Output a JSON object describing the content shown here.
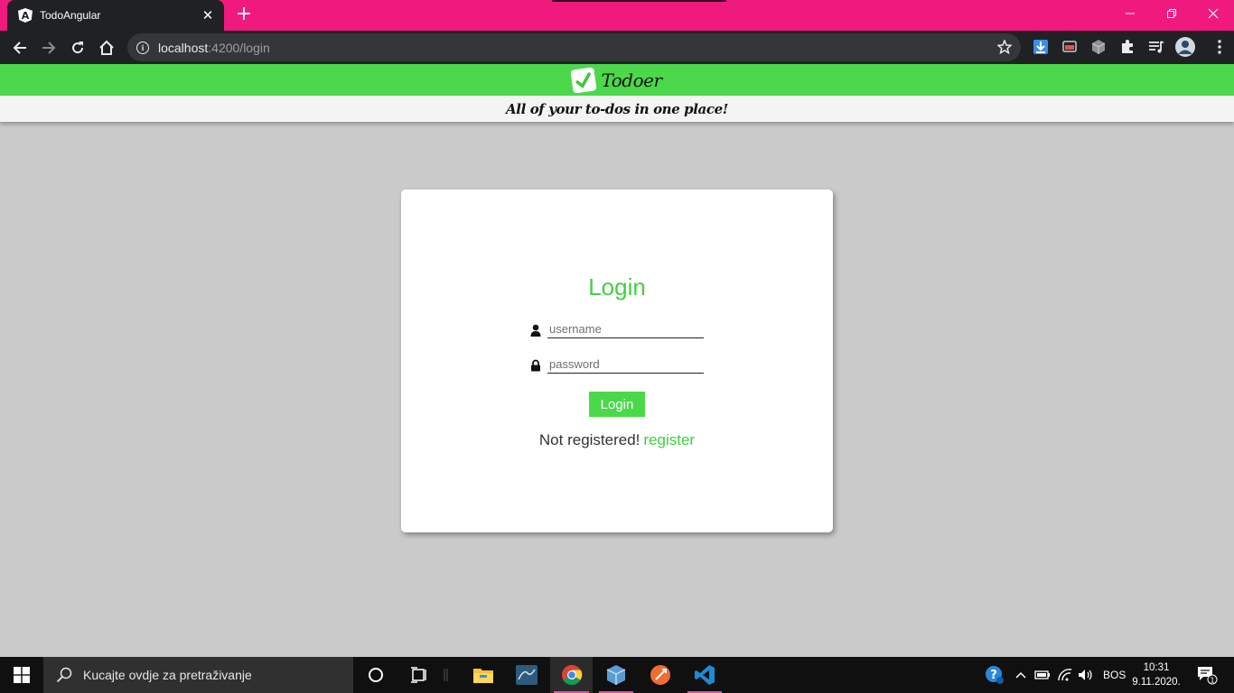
{
  "browser": {
    "tab": {
      "title": "TodoAngular",
      "favicon_letter": "A",
      "close": "✕"
    },
    "new_tab": "+",
    "window_controls": {
      "minimize": "—",
      "restore": "❐",
      "close": "✕"
    },
    "url": {
      "host": "localhost",
      "path": ":4200/login"
    },
    "icons": [
      "back-icon",
      "forward-icon",
      "reload-icon",
      "home-icon",
      "info-icon",
      "star-icon",
      "download-icon",
      "cast-icon",
      "extension-cube-icon",
      "puzzle-icon",
      "media-queue-icon",
      "profile-avatar"
    ]
  },
  "app": {
    "logo_text": "Todoer",
    "tagline": "All of your to-dos in one place!",
    "colors": {
      "accent": "#4cd84b",
      "page_bg": "#cacaca",
      "title_green": "#45cf44"
    }
  },
  "login": {
    "title": "Login",
    "username_placeholder": "username",
    "username_value": "",
    "password_placeholder": "password",
    "password_value": "",
    "button": "Login",
    "not_registered": "Not registered!",
    "register_link": "register"
  },
  "taskbar": {
    "search_placeholder": "Kucajte ovdje za pretraživanje",
    "apps": [
      "file-explorer",
      "mysql-workbench",
      "chrome",
      "virtualbox",
      "postman",
      "vscode"
    ],
    "language": "BOS",
    "time": "10:31",
    "date": "9.11.2020.",
    "notification_count": "1"
  }
}
